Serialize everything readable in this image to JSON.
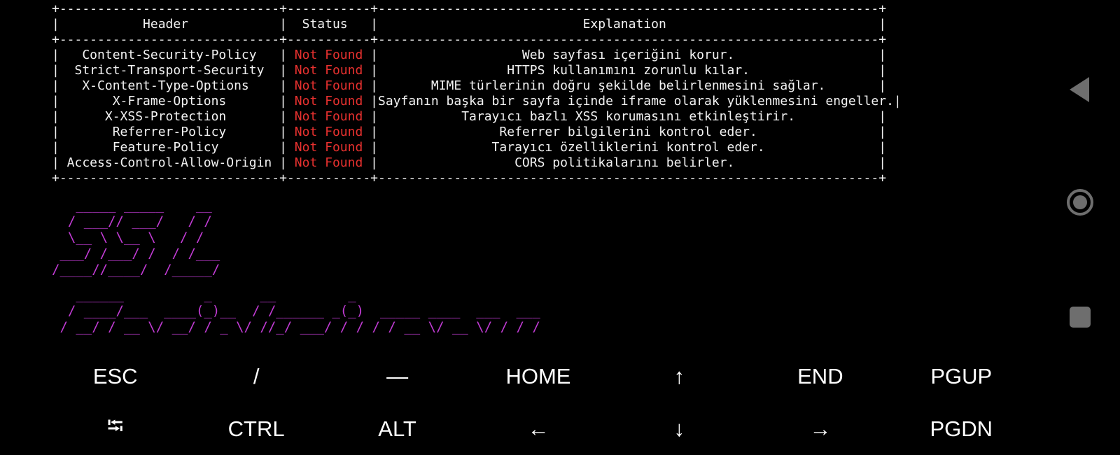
{
  "headers_table": {
    "border": "+-----------------------------+-----------+------------------------------------------------------------------+",
    "columns": [
      "Header",
      "Status",
      "Explanation"
    ],
    "rows": [
      {
        "header": "Content-Security-Policy",
        "status": "Not Found",
        "explanation": "Web sayfası içeriğini korur."
      },
      {
        "header": "Strict-Transport-Security",
        "status": "Not Found",
        "explanation": "HTTPS kullanımını zorunlu kılar."
      },
      {
        "header": "X-Content-Type-Options",
        "status": "Not Found",
        "explanation": "MIME türlerinin doğru şekilde belirlenmesini sağlar."
      },
      {
        "header": "X-Frame-Options",
        "status": "Not Found",
        "explanation": "Sayfanın başka bir sayfa içinde iframe olarak yüklenmesini engeller."
      },
      {
        "header": "X-XSS-Protection",
        "status": "Not Found",
        "explanation": "Tarayıcı bazlı XSS korumasını etkinleştirir."
      },
      {
        "header": "Referrer-Policy",
        "status": "Not Found",
        "explanation": "Referrer bilgilerini kontrol eder."
      },
      {
        "header": "Feature-Policy",
        "status": "Not Found",
        "explanation": "Tarayıcı özelliklerini kontrol eder."
      },
      {
        "header": "Access-Control-Allow-Origin",
        "status": "Not Found",
        "explanation": "CORS politikalarını belirler."
      }
    ],
    "status_color": "#e8312f"
  },
  "banner_ssl": "   _____ _____    __ \n  / ___// ___/   / / \n  \\__ \\ \\__ \\   / /  \n ___/ /___/ /  / /___\n/____//____/  /_____/",
  "banner_second": "   ______          _      __         _ \n  / ____/___  ____(_)__  / /______ _(_)  _____ ____  ___  ___ \n / __/ / __ \\/ __/ / _ \\/ //_/ ___/ / / / / __ \\/ __ \\/ / / /",
  "banner_color": "#c13bd4",
  "extra_keys": {
    "row1": [
      "ESC",
      "/",
      "—",
      "HOME",
      "↑",
      "END",
      "PGUP"
    ],
    "row2": [
      "⭾",
      "CTRL",
      "ALT",
      "←",
      "↓",
      "→",
      "PGDN"
    ]
  },
  "navigation": {
    "back": "back-icon",
    "home": "home-icon",
    "recents": "recents-icon"
  }
}
